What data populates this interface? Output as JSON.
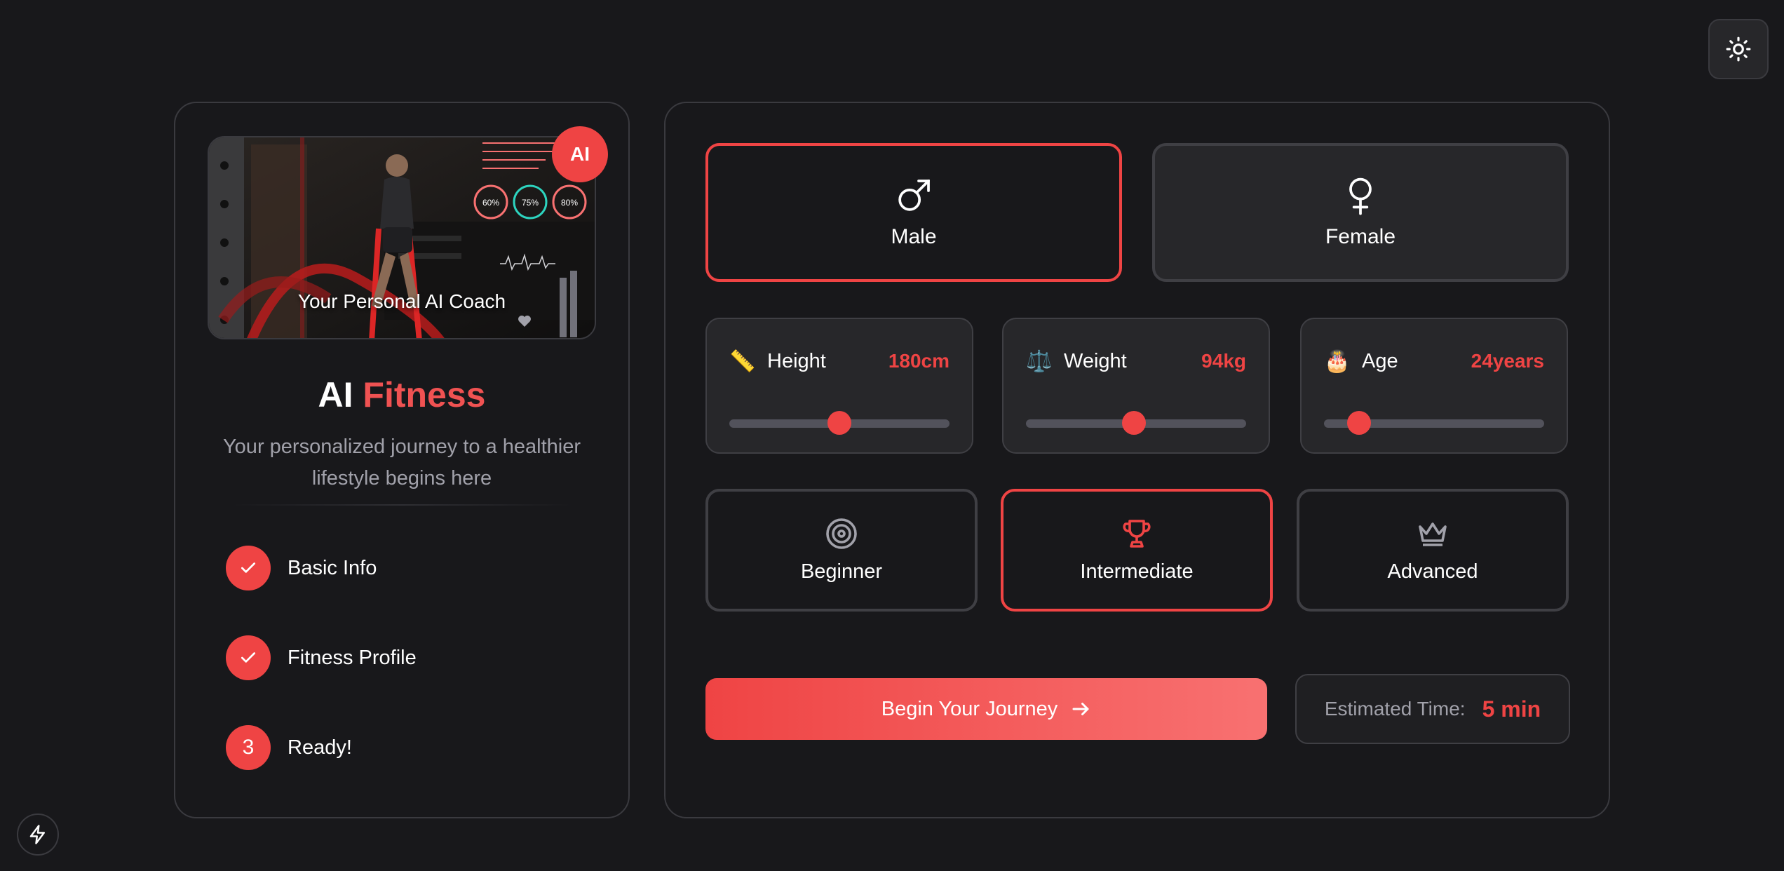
{
  "left_panel": {
    "hero_caption": "Your Personal AI Coach",
    "hero_stats": [
      "60%",
      "75%",
      "80%"
    ],
    "ai_badge": "AI",
    "brand_primary": "AI",
    "brand_accent": "Fitness",
    "tagline": "Your personalized journey to a healthier lifestyle begins here",
    "steps": [
      {
        "marker": "",
        "label": "Basic Info",
        "status": "done"
      },
      {
        "marker": "",
        "label": "Fitness Profile",
        "status": "done"
      },
      {
        "marker": "3",
        "label": "Ready!",
        "status": "current"
      }
    ]
  },
  "gender": {
    "selected": "Male",
    "options": [
      {
        "label": "Male",
        "icon": "male-symbol-icon"
      },
      {
        "label": "Female",
        "icon": "female-symbol-icon"
      }
    ]
  },
  "metrics": [
    {
      "name": "Height",
      "icon": "ruler-icon",
      "value": "180cm",
      "slider_fraction": 0.5
    },
    {
      "name": "Weight",
      "icon": "scale-icon",
      "value": "94kg",
      "slider_fraction": 0.49
    },
    {
      "name": "Age",
      "icon": "cake-icon",
      "value": "24years",
      "slider_fraction": 0.16
    }
  ],
  "levels": {
    "selected": "Intermediate",
    "options": [
      {
        "label": "Beginner",
        "icon": "target-icon"
      },
      {
        "label": "Intermediate",
        "icon": "trophy-icon"
      },
      {
        "label": "Advanced",
        "icon": "crown-icon"
      }
    ]
  },
  "cta": {
    "label": "Begin Your Journey"
  },
  "estimate": {
    "label": "Estimated Time:",
    "value": "5 min"
  },
  "colors": {
    "accent": "#ef4444",
    "background": "#18181b",
    "card": "#27272a",
    "muted_text": "#a1a1aa"
  }
}
